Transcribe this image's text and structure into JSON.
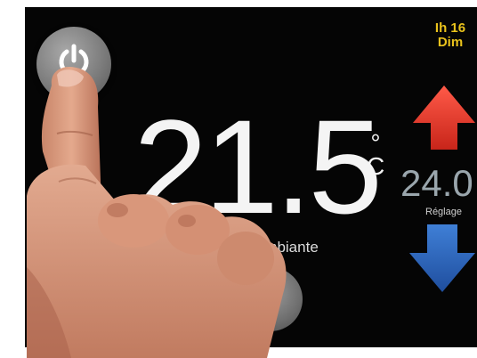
{
  "clock": {
    "time": "Ih 16",
    "day": "Dim"
  },
  "temperature": {
    "value": "21.5",
    "unit": "°\nC",
    "unit_deg": "°",
    "unit_letter": "C",
    "label_visible": "re ambiante"
  },
  "setpoint": {
    "value": "24.0",
    "label": "Réglage"
  },
  "colors": {
    "screen_background": "#050505",
    "clock_text": "#e9c21c",
    "temperature_text": "#f4f4f4",
    "increase_arrow": "#e5392b",
    "decrease_arrow": "#2f6cc4",
    "setpoint_text": "#9aa6ad"
  },
  "icons": {
    "power": "power-icon",
    "increase": "arrow-up-icon",
    "decrease": "arrow-down-icon"
  }
}
